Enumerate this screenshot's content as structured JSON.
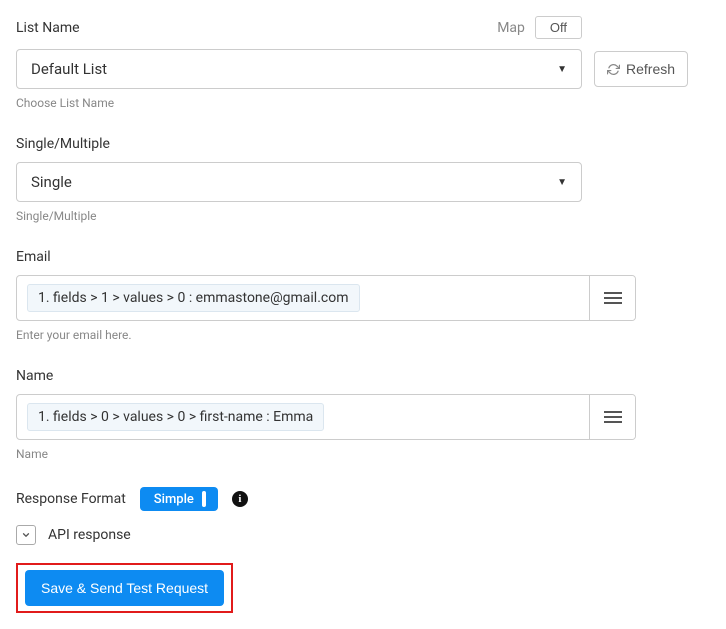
{
  "listName": {
    "label": "List Name",
    "mapLabel": "Map",
    "toggleText": "Off",
    "value": "Default List",
    "helper": "Choose List Name",
    "refreshLabel": "Refresh"
  },
  "singleMultiple": {
    "label": "Single/Multiple",
    "value": "Single",
    "helper": "Single/Multiple"
  },
  "email": {
    "label": "Email",
    "chip": "1. fields > 1 > values > 0 : emmastone@gmail.com",
    "helper": "Enter your email here."
  },
  "name": {
    "label": "Name",
    "chip": "1. fields > 0 > values > 0 > first-name : Emma",
    "helper": "Name"
  },
  "responseFormat": {
    "label": "Response Format",
    "pill": "Simple",
    "info": "i"
  },
  "apiResponse": {
    "label": "API response"
  },
  "saveButton": {
    "label": "Save & Send Test Request"
  }
}
